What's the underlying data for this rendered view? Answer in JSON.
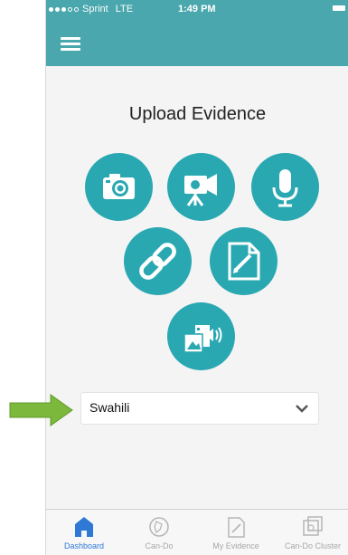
{
  "status_bar": {
    "carrier": "Sprint",
    "network": "LTE",
    "time": "1:49 PM"
  },
  "header": {
    "menu_icon": "hamburger-icon"
  },
  "main": {
    "title": "Upload Evidence",
    "upload_options": [
      {
        "icon": "camera-icon"
      },
      {
        "icon": "video-camera-icon"
      },
      {
        "icon": "microphone-icon"
      },
      {
        "icon": "link-icon"
      },
      {
        "icon": "document-edit-icon"
      },
      {
        "icon": "media-gallery-icon"
      }
    ],
    "language_select": {
      "selected": "Swahili"
    }
  },
  "tabs": [
    {
      "label": "Dashboard",
      "icon": "home-icon",
      "active": true
    },
    {
      "label": "Can-Do",
      "icon": "can-do-icon",
      "active": false
    },
    {
      "label": "My Evidence",
      "icon": "evidence-icon",
      "active": false
    },
    {
      "label": "Can-Do Cluster",
      "icon": "cluster-icon",
      "active": false
    }
  ],
  "colors": {
    "header": "#4aa7ad",
    "button": "#2aa8b2",
    "active_tab": "#2f78d6",
    "arrow": "#7cb83b"
  }
}
